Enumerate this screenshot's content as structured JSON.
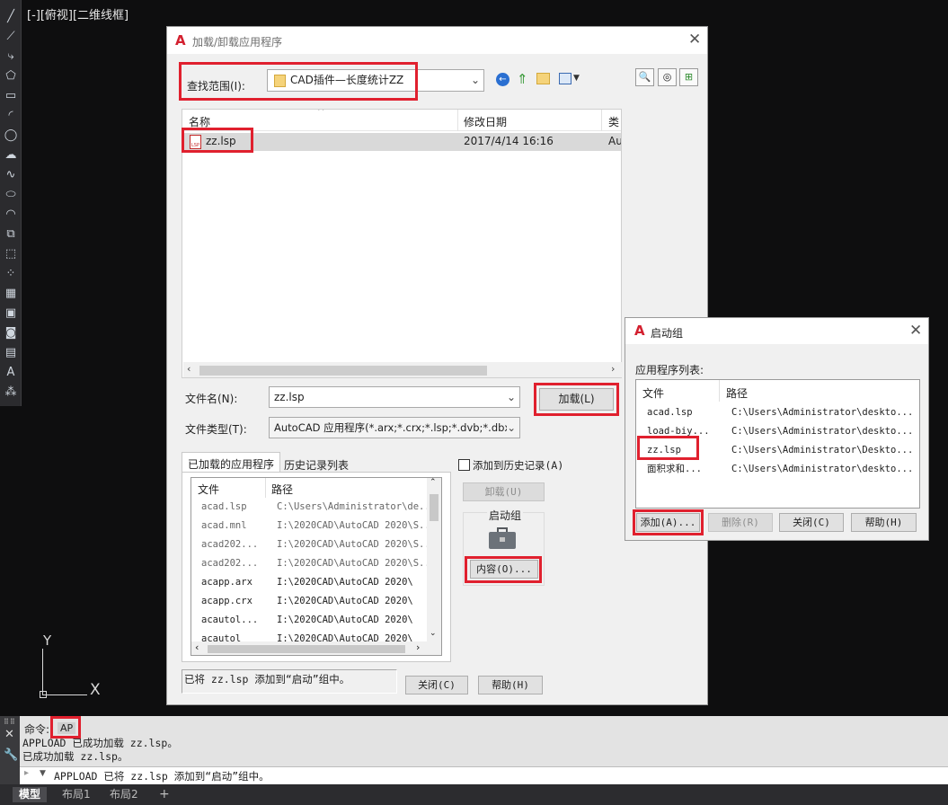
{
  "viewport": {
    "label": "[-][俯视][二维线框]"
  },
  "ucs": {
    "y": "Y",
    "x": "X"
  },
  "main_dialog": {
    "logo": "A",
    "title": "加载/卸载应用程序",
    "close_symbol": "✕",
    "look_in_label": "查找范围(I):",
    "look_in_value": "CAD插件—长度统计ZZ",
    "file_list": {
      "col_name": "名称",
      "col_date": "修改日期",
      "col_type": "类",
      "rows": [
        {
          "name": "zz.lsp",
          "date": "2017/4/14 16:16",
          "type": "Au"
        }
      ]
    },
    "filename_label": "文件名(N):",
    "filename_value": "zz.lsp",
    "filetype_label": "文件类型(T):",
    "filetype_value": "AutoCAD 应用程序(*.arx;*.crx;*.lsp;*.dvb;*.dbx",
    "load_button": "加载(L)",
    "tab_loaded": "已加载的应用程序",
    "tab_history": "历史记录列表",
    "add_to_history": "添加到历史记录(A)",
    "unload_button": "卸载(U)",
    "startup_group_label": "启动组",
    "contents_button": "内容(O)...",
    "loaded_list": {
      "col_file": "文件",
      "col_path": "路径",
      "rows": [
        {
          "file": "acad.lsp",
          "path": "C:\\Users\\Administrator\\de..."
        },
        {
          "file": "acad.mnl",
          "path": "I:\\2020CAD\\AutoCAD 2020\\S..."
        },
        {
          "file": "acad202...",
          "path": "I:\\2020CAD\\AutoCAD 2020\\S..."
        },
        {
          "file": "acad202...",
          "path": "I:\\2020CAD\\AutoCAD 2020\\S..."
        },
        {
          "file": "acapp.arx",
          "path": "I:\\2020CAD\\AutoCAD 2020\\"
        },
        {
          "file": "acapp.crx",
          "path": "I:\\2020CAD\\AutoCAD 2020\\"
        },
        {
          "file": "acautol...",
          "path": "I:\\2020CAD\\AutoCAD 2020\\"
        },
        {
          "file": "acautol",
          "path": "I:\\2020CAD\\AutoCAD 2020\\"
        }
      ]
    },
    "status_message": "已将 zz.lsp 添加到“启动”组中。",
    "close_button": "关闭(C)",
    "help_button": "帮助(H)"
  },
  "startup_dialog": {
    "logo": "A",
    "title": "启动组",
    "close_symbol": "✕",
    "list_label": "应用程序列表:",
    "col_file": "文件",
    "col_path": "路径",
    "rows": [
      {
        "file": "acad.lsp",
        "path": "C:\\Users\\Administrator\\deskto..."
      },
      {
        "file": "load-biy...",
        "path": "C:\\Users\\Administrator\\deskto..."
      },
      {
        "file": "zz.lsp",
        "path": "C:\\Users\\Administrator\\Deskto..."
      },
      {
        "file": "面积求和...",
        "path": "C:\\Users\\Administrator\\deskto..."
      }
    ],
    "add_button": "添加(A)...",
    "remove_button": "删除(R)",
    "close_button": "关闭(C)",
    "help_button": "帮助(H)"
  },
  "command": {
    "prompt": "命令:",
    "input_echo": "AP",
    "history_1": "APPLOAD 已成功加载 zz.lsp。",
    "history_2": "已成功加载 zz.lsp。",
    "current_line": "APPLOAD 已将 zz.lsp 添加到“启动”组中。"
  },
  "layout_tabs": [
    "模型",
    "布局1",
    "布局2",
    "+"
  ],
  "colors": {
    "highlight_red": "#e0202e",
    "brand_red": "#d3202f",
    "selection_gray": "#d9d9d9"
  }
}
